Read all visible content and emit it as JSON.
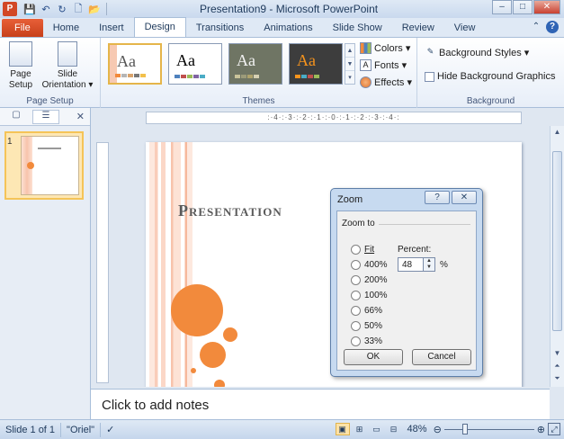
{
  "window": {
    "title": "Presentation9 - Microsoft PowerPoint",
    "app_icon": "P",
    "minimize": "–",
    "maximize": "□",
    "close": "✕"
  },
  "qat": {
    "save": "💾",
    "undo": "↶",
    "redo": "↻",
    "new": "🗋",
    "open": "📂"
  },
  "tabs": [
    {
      "label": "File"
    },
    {
      "label": "Home"
    },
    {
      "label": "Insert"
    },
    {
      "label": "Design"
    },
    {
      "label": "Transitions"
    },
    {
      "label": "Animations"
    },
    {
      "label": "Slide Show"
    },
    {
      "label": "Review"
    },
    {
      "label": "View"
    }
  ],
  "ribbon": {
    "page_setup": {
      "page_setup_label": "Page\nSetup",
      "orientation_label": "Slide\nOrientation ▾",
      "group_label": "Page Setup"
    },
    "themes": {
      "group_label": "Themes",
      "thumb_text": "Aa",
      "colors": "Colors ▾",
      "fonts": "Fonts ▾",
      "effects": "Effects ▾",
      "fonts_icon": "A"
    },
    "background": {
      "styles": "Background Styles ▾",
      "hide_graphics": "Hide Background Graphics",
      "group_label": "Background"
    }
  },
  "left_pane": {
    "slide_number": "1"
  },
  "ruler": {
    "h_ticks": ":·4·:·3·:·2·:·1·:·0·:·1·:·2·:·3·:·4·:"
  },
  "slide": {
    "title": "Presentation"
  },
  "notes": {
    "placeholder": "Click to add notes"
  },
  "status": {
    "slide_info": "Slide 1 of 1",
    "theme": "\"Oriel\"",
    "zoom_pct": "48%",
    "zoom_level": 0.48
  },
  "dialog": {
    "title": "Zoom",
    "help_btn": "?",
    "close_btn": "✕",
    "zoom_to_label": "Zoom to",
    "options": [
      "Fit",
      "400%",
      "200%",
      "100%",
      "66%",
      "50%",
      "33%"
    ],
    "percent_label": "Percent:",
    "percent_value": "48",
    "percent_unit": "%",
    "ok": "OK",
    "cancel": "Cancel"
  },
  "colors": {
    "accent_orange": "#f28a3c",
    "file_tab": "#d24726",
    "ribbon_bg": "#dfe9f5"
  }
}
